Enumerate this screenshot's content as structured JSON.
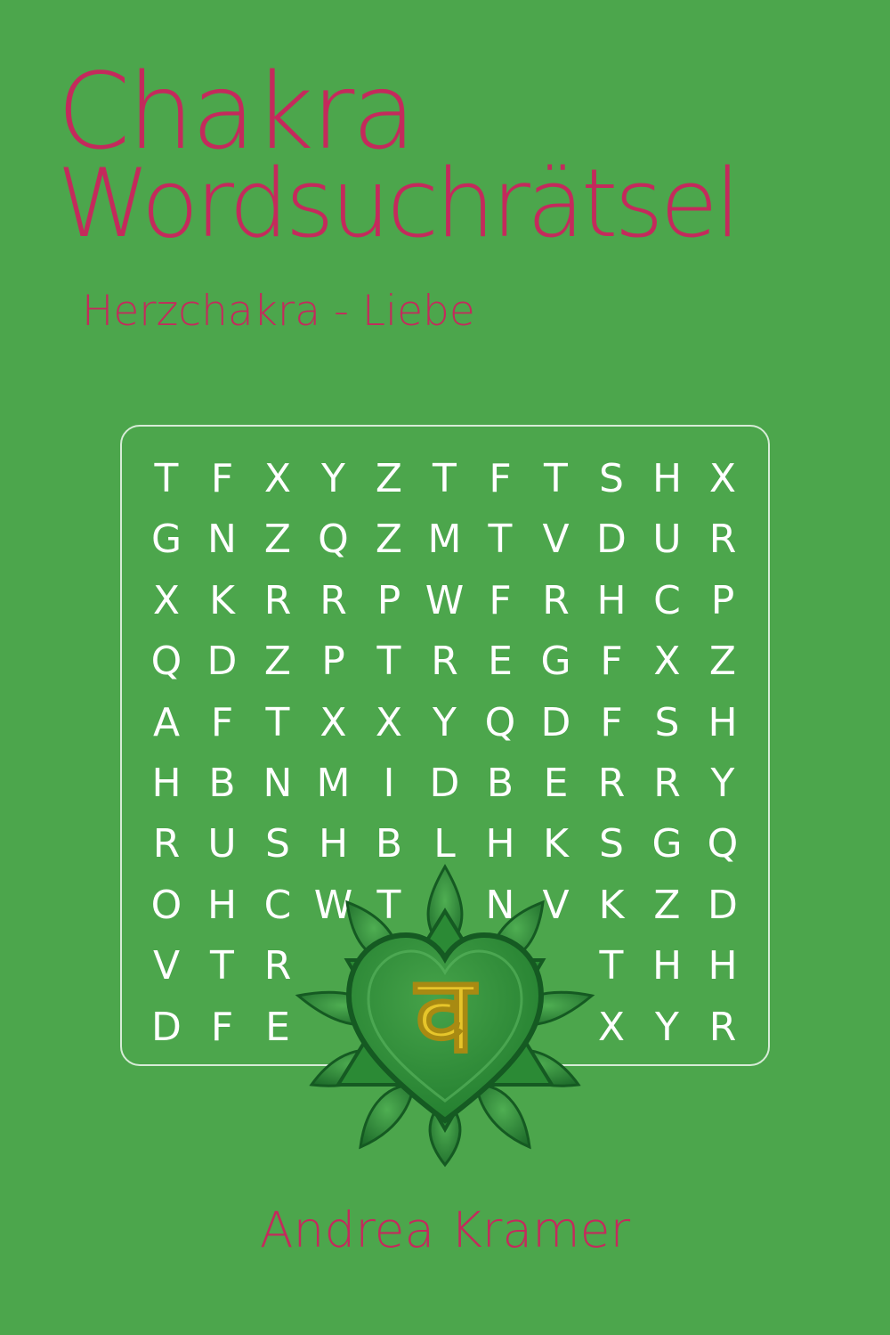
{
  "cover": {
    "title_line1": "Chakra",
    "title_line2": "Wordsuchrätsel",
    "subtitle": "Herzchakra - Liebe",
    "author": "Andrea Kramer",
    "emblem_glyph": "व",
    "emblem_icon": "heart-chakra-lotus-icon"
  },
  "colors": {
    "background": "#4ca64c",
    "title": "#c42a5c",
    "grid_text": "#ffffff",
    "emblem_dark": "#1d6b2a",
    "emblem_light": "#3f9a45",
    "glyph": "#e6c52a"
  },
  "puzzle": {
    "rows": [
      [
        "T",
        "F",
        "X",
        "Y",
        "Z",
        "T",
        "F",
        "T",
        "S",
        "H",
        "X"
      ],
      [
        "G",
        "N",
        "Z",
        "Q",
        "Z",
        "M",
        "T",
        "V",
        "D",
        "U",
        "R"
      ],
      [
        "X",
        "K",
        "R",
        "R",
        "P",
        "W",
        "F",
        "R",
        "H",
        "C",
        "P"
      ],
      [
        "Q",
        "D",
        "Z",
        "P",
        "T",
        "R",
        "E",
        "G",
        "F",
        "X",
        "Z"
      ],
      [
        "A",
        "F",
        "T",
        "X",
        "X",
        "Y",
        "Q",
        "D",
        "F",
        "S",
        "H"
      ],
      [
        "H",
        "B",
        "N",
        "M",
        "I",
        "D",
        "B",
        "E",
        "R",
        "R",
        "Y"
      ],
      [
        "R",
        "U",
        "S",
        "H",
        "B",
        "L",
        "H",
        "K",
        "S",
        "G",
        "Q"
      ],
      [
        "O",
        "H",
        "C",
        "W",
        "T",
        "",
        "N",
        "V",
        "K",
        "Z",
        "D"
      ],
      [
        "V",
        "T",
        "R",
        "",
        "",
        "",
        "",
        "",
        "T",
        "H",
        "H"
      ],
      [
        "D",
        "F",
        "E",
        "",
        "",
        "",
        "",
        "",
        "X",
        "Y",
        "R"
      ]
    ]
  }
}
